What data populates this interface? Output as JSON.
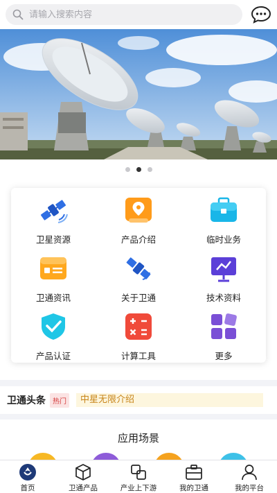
{
  "search": {
    "placeholder": "请输入搜索内容"
  },
  "header": {
    "message_icon": "chat-bubble-icon"
  },
  "banner": {
    "slide_count": 3,
    "active_slide": 2
  },
  "grid": {
    "items": [
      {
        "label": "卫星资源",
        "icon": "satellite-icon",
        "color": "#2f6fe4"
      },
      {
        "label": "产品介绍",
        "icon": "map-pin-icon",
        "color": "#ff9b1a"
      },
      {
        "label": "临时业务",
        "icon": "briefcase-icon",
        "color": "#19b6e8"
      },
      {
        "label": "卫通资讯",
        "icon": "news-icon",
        "color": "#ffa81e"
      },
      {
        "label": "关于卫通",
        "icon": "satellite-icon",
        "color": "#2f6fe4"
      },
      {
        "label": "技术资料",
        "icon": "presentation-board-icon",
        "color": "#5b3fd8"
      },
      {
        "label": "产品认证",
        "icon": "shield-check-icon",
        "color": "#1fc6e6"
      },
      {
        "label": "计算工具",
        "icon": "calculator-icon",
        "color": "#f04a3a"
      },
      {
        "label": "更多",
        "icon": "more-grid-icon",
        "color": "#7a4fd6"
      }
    ]
  },
  "news": {
    "title": "卫通头条",
    "badge": "热门",
    "headline": "中星无限介绍"
  },
  "scenes": {
    "title": "应用场景",
    "circle_colors": [
      "#f7b824",
      "#8e5cd9",
      "#f5a21e",
      "#3ec1e8"
    ]
  },
  "tabbar": {
    "tabs": [
      {
        "label": "首页",
        "icon": "home-icon",
        "active": true
      },
      {
        "label": "卫通产品",
        "icon": "box-icon",
        "active": false
      },
      {
        "label": "产业上下游",
        "icon": "chain-icon",
        "active": false
      },
      {
        "label": "我的卫通",
        "icon": "briefcase-icon",
        "active": false
      },
      {
        "label": "我的平台",
        "icon": "user-icon",
        "active": false
      }
    ]
  }
}
